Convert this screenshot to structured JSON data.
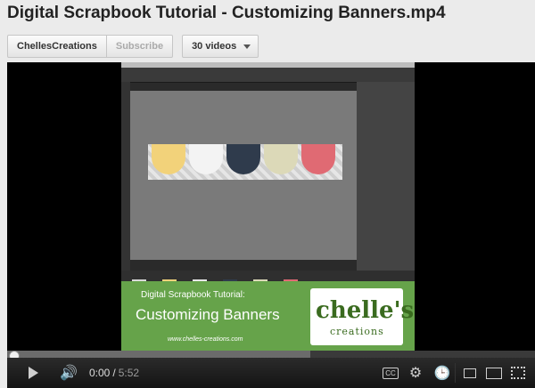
{
  "page": {
    "title": "Digital Scrapbook Tutorial - Customizing Banners.mp4"
  },
  "toolbar": {
    "channel_label": "ChellesCreations",
    "subscribe_label": "Subscribe",
    "videos_label": "30 videos"
  },
  "video": {
    "promo": {
      "line1": "Digital Scrapbook Tutorial:",
      "line2": "Customizing Banners",
      "url": "www.chelles-creations.com",
      "logo_main": "chelle's",
      "logo_sub": "creations"
    },
    "progress_fraction": 0.0
  },
  "player": {
    "current_time": "0:00",
    "separator": "/",
    "duration": "5:52"
  },
  "colors": {
    "player_bg": "#000000",
    "promo_green": "#66a34a",
    "page_bg": "#ebebeb"
  },
  "icons": {
    "play": "play-icon",
    "volume": "volume-icon",
    "captions": "closed-captions-icon",
    "settings": "gear-icon",
    "watch_later": "clock-icon",
    "small_player": "small-player-icon",
    "large_player": "large-player-icon",
    "fullscreen": "fullscreen-icon"
  }
}
